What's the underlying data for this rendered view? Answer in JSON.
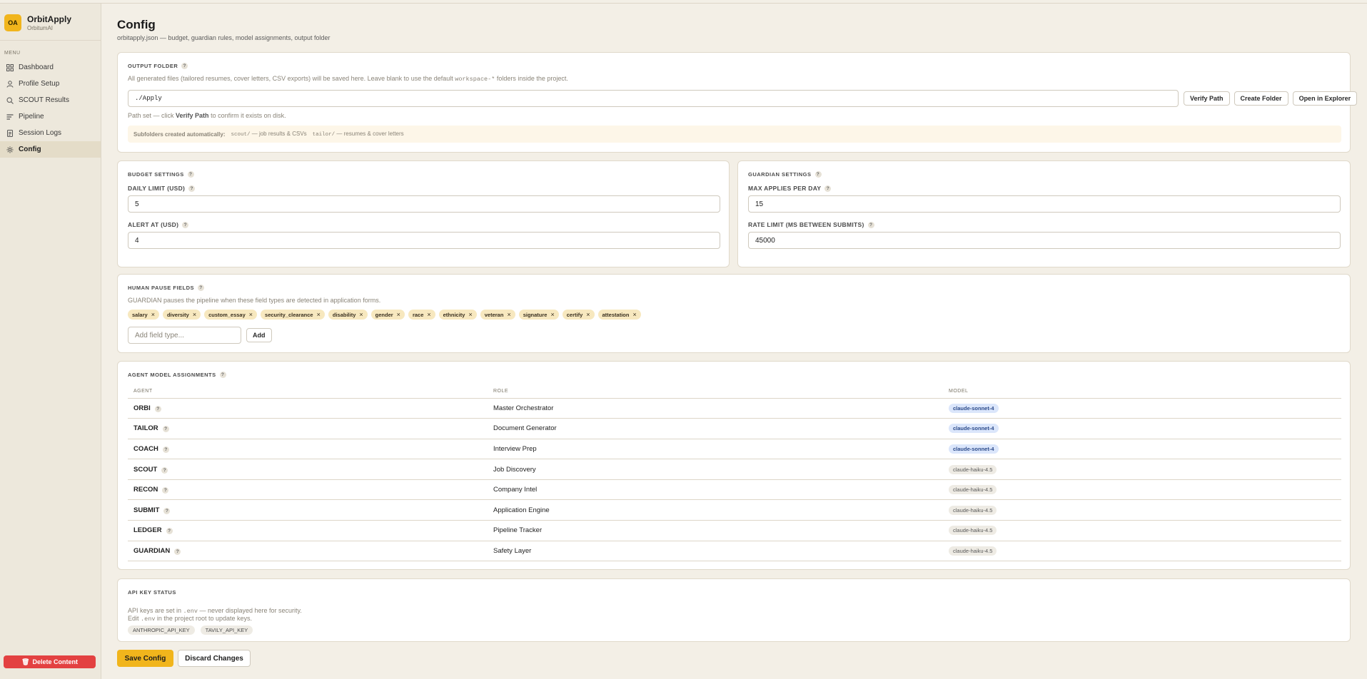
{
  "brand": {
    "logo_text": "OA",
    "name": "OrbitApply",
    "sub": "OrbitumAI"
  },
  "sidebar": {
    "menu_label": "MENU",
    "items": [
      {
        "label": "Dashboard",
        "icon": "grid-icon"
      },
      {
        "label": "Profile Setup",
        "icon": "user-icon"
      },
      {
        "label": "SCOUT Results",
        "icon": "search-icon"
      },
      {
        "label": "Pipeline",
        "icon": "list-icon"
      },
      {
        "label": "Session Logs",
        "icon": "document-icon"
      },
      {
        "label": "Config",
        "icon": "gear-icon",
        "active": true
      }
    ],
    "delete_label": "Delete Content"
  },
  "page": {
    "title": "Config",
    "subtitle": "orbitapply.json — budget, guardian rules, model assignments, output folder"
  },
  "output_folder": {
    "title": "OUTPUT FOLDER",
    "desc_pre": "All generated files (tailored resumes, cover letters, CSV exports) will be saved here. Leave blank to use the default ",
    "desc_code": "workspace-*",
    "desc_post": " folders inside the project.",
    "path_value": "./Apply",
    "verify_label": "Verify Path",
    "create_label": "Create Folder",
    "explorer_label": "Open in Explorer",
    "hint_pre": "Path set — click ",
    "hint_bold": "Verify Path",
    "hint_post": " to confirm it exists on disk.",
    "subfolders_label": "Subfolders created automatically:",
    "sub1_code": "scout/",
    "sub1_desc": "— job results & CSVs",
    "sub2_code": "tailor/",
    "sub2_desc": "— resumes & cover letters"
  },
  "budget": {
    "title": "BUDGET SETTINGS",
    "daily_label": "DAILY LIMIT (USD)",
    "daily_value": "5",
    "alert_label": "ALERT AT (USD)",
    "alert_value": "4"
  },
  "guardian": {
    "title": "GUARDIAN SETTINGS",
    "max_label": "MAX APPLIES PER DAY",
    "max_value": "15",
    "rate_label": "RATE LIMIT (MS BETWEEN SUBMITS)",
    "rate_value": "45000"
  },
  "pause_fields": {
    "title": "HUMAN PAUSE FIELDS",
    "desc": "GUARDIAN pauses the pipeline when these field types are detected in application forms.",
    "chips": [
      "salary",
      "diversity",
      "custom_essay",
      "security_clearance",
      "disability",
      "gender",
      "race",
      "ethnicity",
      "veteran",
      "signature",
      "certify",
      "attestation"
    ],
    "add_placeholder": "Add field type...",
    "add_label": "Add"
  },
  "agents": {
    "title": "AGENT MODEL ASSIGNMENTS",
    "headers": [
      "AGENT",
      "ROLE",
      "MODEL"
    ],
    "rows": [
      {
        "agent": "ORBI",
        "role": "Master Orchestrator",
        "model": "claude-sonnet-4",
        "tier": "sonnet"
      },
      {
        "agent": "TAILOR",
        "role": "Document Generator",
        "model": "claude-sonnet-4",
        "tier": "sonnet"
      },
      {
        "agent": "COACH",
        "role": "Interview Prep",
        "model": "claude-sonnet-4",
        "tier": "sonnet"
      },
      {
        "agent": "SCOUT",
        "role": "Job Discovery",
        "model": "claude-haiku-4.5",
        "tier": "haiku"
      },
      {
        "agent": "RECON",
        "role": "Company Intel",
        "model": "claude-haiku-4.5",
        "tier": "haiku"
      },
      {
        "agent": "SUBMIT",
        "role": "Application Engine",
        "model": "claude-haiku-4.5",
        "tier": "haiku"
      },
      {
        "agent": "LEDGER",
        "role": "Pipeline Tracker",
        "model": "claude-haiku-4.5",
        "tier": "haiku"
      },
      {
        "agent": "GUARDIAN",
        "role": "Safety Layer",
        "model": "claude-haiku-4.5",
        "tier": "haiku"
      }
    ]
  },
  "api": {
    "title": "API KEY STATUS",
    "line1_pre": "API keys are set in ",
    "line1_code": ".env",
    "line1_post": " — never displayed here for security.",
    "line2_pre": "Edit ",
    "line2_code": ".env",
    "line2_post": " in the project root to update keys.",
    "keys": [
      "ANTHROPIC_API_KEY",
      "TAVILY_API_KEY"
    ]
  },
  "actions": {
    "save_label": "Save Config",
    "discard_label": "Discard Changes"
  },
  "colors": {
    "accent": "#f1b51c",
    "danger": "#e34141",
    "background": "#f3efe6"
  }
}
